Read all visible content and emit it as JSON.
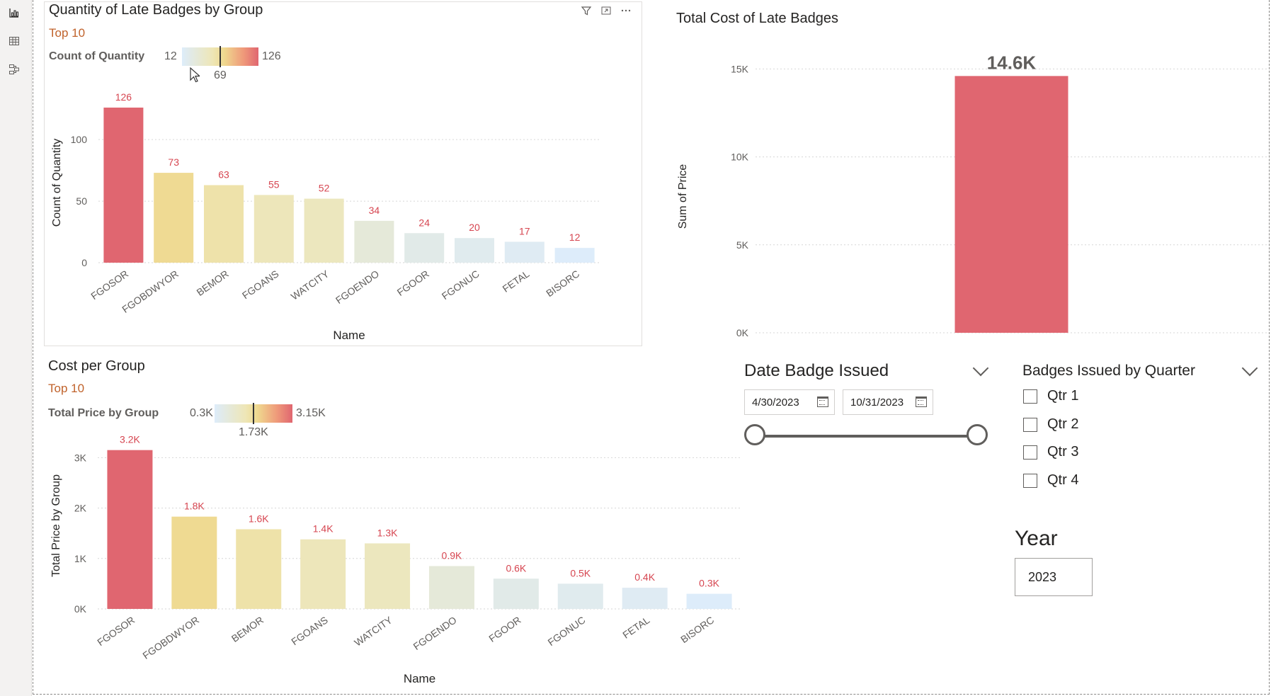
{
  "colors": {
    "accent_red": "#e06670",
    "subtitle_orange": "#c0622b",
    "axis_text": "#605e5c",
    "grid": "#dcdcdc"
  },
  "rail": {
    "icons": [
      "report-view-icon",
      "table-view-icon",
      "model-view-icon"
    ]
  },
  "quantity_visual": {
    "title": "Quantity of Late Badges by Group",
    "subtitle": "Top 10",
    "legend": {
      "label": "Count of Quantity",
      "min": "12",
      "max": "126",
      "mid": "69"
    }
  },
  "cost_group_visual": {
    "title": "Cost per Group",
    "subtitle": "Top 10",
    "legend": {
      "label": "Total Price by Group",
      "min": "0.3K",
      "max": "3.15K",
      "mid": "1.73K"
    }
  },
  "total_cost_visual": {
    "title": "Total Cost of Late Badges"
  },
  "date_slicer": {
    "title": "Date Badge Issued",
    "start": "4/30/2023",
    "end": "10/31/2023"
  },
  "quarter_slicer": {
    "title": "Badges Issued by Quarter",
    "options": [
      "Qtr 1",
      "Qtr 2",
      "Qtr 3",
      "Qtr 4"
    ]
  },
  "year_card": {
    "title": "Year",
    "value": "2023"
  },
  "chart_data": [
    {
      "type": "bar",
      "title": "Quantity of Late Badges by Group",
      "categories": [
        "FGOSOR",
        "FGOBDWYOR",
        "BEMOR",
        "FGOANS",
        "WATCITY",
        "FGOENDO",
        "FGOOR",
        "FGONUC",
        "FETAL",
        "BISORC"
      ],
      "values": [
        126,
        73,
        63,
        55,
        52,
        34,
        24,
        20,
        17,
        12
      ],
      "data_labels": [
        "126",
        "73",
        "63",
        "55",
        "52",
        "34",
        "24",
        "20",
        "17",
        "12"
      ],
      "xlabel": "Name",
      "ylabel": "Count of Quantity",
      "ylim": [
        0,
        130
      ],
      "yticks": [
        0,
        50,
        100
      ],
      "ytick_labels": [
        "0",
        "50",
        "100"
      ],
      "grid": true,
      "color_min": 12,
      "color_max": 126
    },
    {
      "type": "bar",
      "title": "Cost per Group",
      "categories": [
        "FGOSOR",
        "FGOBDWYOR",
        "BEMOR",
        "FGOANS",
        "WATCITY",
        "FGOENDO",
        "FGOOR",
        "FGONUC",
        "FETAL",
        "BISORC"
      ],
      "values": [
        3150,
        1830,
        1580,
        1380,
        1300,
        850,
        600,
        500,
        420,
        300
      ],
      "data_labels": [
        "3.2K",
        "1.8K",
        "1.6K",
        "1.4K",
        "1.3K",
        "0.9K",
        "0.6K",
        "0.5K",
        "0.4K",
        "0.3K"
      ],
      "xlabel": "Name",
      "ylabel": "Total Price by Group",
      "ylim": [
        0,
        3300
      ],
      "yticks": [
        0,
        1000,
        2000,
        3000
      ],
      "ytick_labels": [
        "0K",
        "1K",
        "2K",
        "3K"
      ],
      "grid": true,
      "color_min": 300,
      "color_max": 3150
    },
    {
      "type": "bar",
      "title": "Total Cost of Late Badges",
      "categories": [
        ""
      ],
      "values": [
        14600
      ],
      "data_labels": [
        "14.6K"
      ],
      "xlabel": "",
      "ylabel": "Sum of Price",
      "ylim": [
        0,
        15500
      ],
      "yticks": [
        0,
        5000,
        10000,
        15000
      ],
      "ytick_labels": [
        "0K",
        "5K",
        "10K",
        "15K"
      ],
      "grid": true,
      "color_min": 0,
      "color_max": 14600
    }
  ]
}
